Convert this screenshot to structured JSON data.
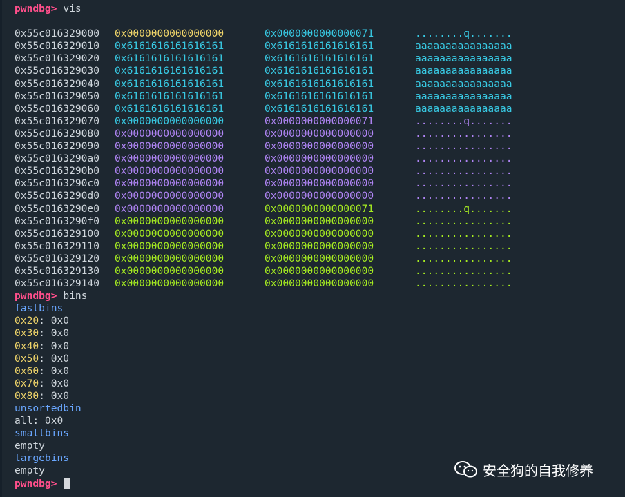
{
  "prompt": "pwndbg>",
  "commands": {
    "vis": "vis",
    "bins": "bins",
    "final": ""
  },
  "heap": [
    {
      "addr": "0x55c016329000",
      "q1": "0x0000000000000000",
      "q2": "0x0000000000000071",
      "ascii": "........q.......",
      "c1": "yellow",
      "c2": "cyan",
      "ca": "cyan"
    },
    {
      "addr": "0x55c016329010",
      "q1": "0x6161616161616161",
      "q2": "0x6161616161616161",
      "ascii": "aaaaaaaaaaaaaaaa",
      "c1": "cyan",
      "c2": "cyan",
      "ca": "cyan"
    },
    {
      "addr": "0x55c016329020",
      "q1": "0x6161616161616161",
      "q2": "0x6161616161616161",
      "ascii": "aaaaaaaaaaaaaaaa",
      "c1": "cyan",
      "c2": "cyan",
      "ca": "cyan"
    },
    {
      "addr": "0x55c016329030",
      "q1": "0x6161616161616161",
      "q2": "0x6161616161616161",
      "ascii": "aaaaaaaaaaaaaaaa",
      "c1": "cyan",
      "c2": "cyan",
      "ca": "cyan"
    },
    {
      "addr": "0x55c016329040",
      "q1": "0x6161616161616161",
      "q2": "0x6161616161616161",
      "ascii": "aaaaaaaaaaaaaaaa",
      "c1": "cyan",
      "c2": "cyan",
      "ca": "cyan"
    },
    {
      "addr": "0x55c016329050",
      "q1": "0x6161616161616161",
      "q2": "0x6161616161616161",
      "ascii": "aaaaaaaaaaaaaaaa",
      "c1": "cyan",
      "c2": "cyan",
      "ca": "cyan"
    },
    {
      "addr": "0x55c016329060",
      "q1": "0x6161616161616161",
      "q2": "0x6161616161616161",
      "ascii": "aaaaaaaaaaaaaaaa",
      "c1": "cyan",
      "c2": "cyan",
      "ca": "cyan"
    },
    {
      "addr": "0x55c016329070",
      "q1": "0x0000000000000000",
      "q2": "0x0000000000000071",
      "ascii": "........q.......",
      "c1": "cyan",
      "c2": "purple",
      "ca": "purple"
    },
    {
      "addr": "0x55c016329080",
      "q1": "0x0000000000000000",
      "q2": "0x0000000000000000",
      "ascii": "................",
      "c1": "purple",
      "c2": "purple",
      "ca": "purple"
    },
    {
      "addr": "0x55c016329090",
      "q1": "0x0000000000000000",
      "q2": "0x0000000000000000",
      "ascii": "................",
      "c1": "purple",
      "c2": "purple",
      "ca": "purple"
    },
    {
      "addr": "0x55c0163290a0",
      "q1": "0x0000000000000000",
      "q2": "0x0000000000000000",
      "ascii": "................",
      "c1": "purple",
      "c2": "purple",
      "ca": "purple"
    },
    {
      "addr": "0x55c0163290b0",
      "q1": "0x0000000000000000",
      "q2": "0x0000000000000000",
      "ascii": "................",
      "c1": "purple",
      "c2": "purple",
      "ca": "purple"
    },
    {
      "addr": "0x55c0163290c0",
      "q1": "0x0000000000000000",
      "q2": "0x0000000000000000",
      "ascii": "................",
      "c1": "purple",
      "c2": "purple",
      "ca": "purple"
    },
    {
      "addr": "0x55c0163290d0",
      "q1": "0x0000000000000000",
      "q2": "0x0000000000000000",
      "ascii": "................",
      "c1": "purple",
      "c2": "purple",
      "ca": "purple"
    },
    {
      "addr": "0x55c0163290e0",
      "q1": "0x0000000000000000",
      "q2": "0x0000000000000071",
      "ascii": "........q.......",
      "c1": "purple",
      "c2": "green",
      "ca": "green"
    },
    {
      "addr": "0x55c0163290f0",
      "q1": "0x0000000000000000",
      "q2": "0x0000000000000000",
      "ascii": "................",
      "c1": "green",
      "c2": "green",
      "ca": "green"
    },
    {
      "addr": "0x55c016329100",
      "q1": "0x0000000000000000",
      "q2": "0x0000000000000000",
      "ascii": "................",
      "c1": "green",
      "c2": "green",
      "ca": "green"
    },
    {
      "addr": "0x55c016329110",
      "q1": "0x0000000000000000",
      "q2": "0x0000000000000000",
      "ascii": "................",
      "c1": "green",
      "c2": "green",
      "ca": "green"
    },
    {
      "addr": "0x55c016329120",
      "q1": "0x0000000000000000",
      "q2": "0x0000000000000000",
      "ascii": "................",
      "c1": "green",
      "c2": "green",
      "ca": "green"
    },
    {
      "addr": "0x55c016329130",
      "q1": "0x0000000000000000",
      "q2": "0x0000000000000000",
      "ascii": "................",
      "c1": "green",
      "c2": "green",
      "ca": "green"
    },
    {
      "addr": "0x55c016329140",
      "q1": "0x0000000000000000",
      "q2": "0x0000000000000000",
      "ascii": "................",
      "c1": "green",
      "c2": "green",
      "ca": "green"
    }
  ],
  "bins": {
    "fastbins_label": "fastbins",
    "fastbins": [
      {
        "size": "0x20",
        "value": ": 0x0"
      },
      {
        "size": "0x30",
        "value": ": 0x0"
      },
      {
        "size": "0x40",
        "value": ": 0x0"
      },
      {
        "size": "0x50",
        "value": ": 0x0"
      },
      {
        "size": "0x60",
        "value": ": 0x0"
      },
      {
        "size": "0x70",
        "value": ": 0x0"
      },
      {
        "size": "0x80",
        "value": ": 0x0"
      }
    ],
    "unsorted_label": "unsortedbin",
    "unsorted_all": "all: 0x0",
    "smallbins_label": "smallbins",
    "smallbins_value": "empty",
    "largebins_label": "largebins",
    "largebins_value": "empty"
  },
  "watermark": {
    "text": "安全狗的自我修养",
    "icon": "wechat-icon"
  },
  "colors": {
    "yellow": "#f0d56a",
    "cyan": "#38c9e3",
    "purple": "#b085f5",
    "green": "#a6ec21",
    "prompt": "#ff4f8b",
    "label": "#6aa7ff",
    "background": "#1d2730"
  }
}
